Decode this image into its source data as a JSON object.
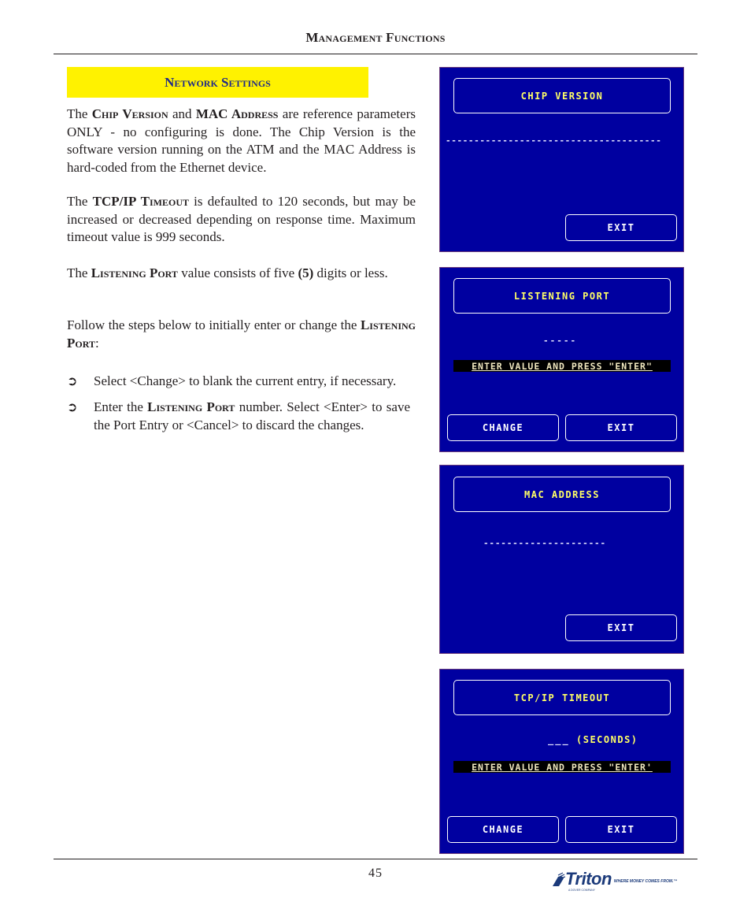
{
  "header": {
    "running_title": "Management Functions"
  },
  "section": {
    "title": "Network Settings"
  },
  "body": {
    "p1": {
      "t1": "The ",
      "chip_version": "Chip Version",
      "t2": " and ",
      "mac": "MAC",
      "address": " Address",
      "t3": " are reference parameters ONLY - no configuring is done.  The Chip Version is the software version running on the ATM and the MAC Address is hard-coded from the Ethernet device."
    },
    "p2": {
      "t1": "The ",
      "tcpip": "TCP/IP ",
      "timeout": "Timeout",
      "t2": " is defaulted to 120 seconds, but may be increased or decreased depending on response time. Maximum timeout value is 999 seconds."
    },
    "p3": {
      "t1": "The ",
      "listening_port": "Listening Port",
      "t2": " value consists of five ",
      "five": "(5)",
      "t3": " digits or less."
    },
    "p4": {
      "t1": "Follow the steps below to initially enter or change the ",
      "listening_port": "Listening Port",
      "t2": ":"
    },
    "steps": [
      {
        "arrow": "➲",
        "t1": "Select <Change> to blank the current entry, if necessary."
      },
      {
        "arrow": "➲",
        "t1": "Enter the ",
        "listening_port": "Listening Port",
        "t2": " number. Select <Enter> to save the Port Entry or <Cancel> to discard  the changes."
      }
    ]
  },
  "screens": {
    "chip_version": {
      "title": "CHIP VERSION",
      "value_placeholder": "--------------------------------------",
      "exit_label": "EXIT"
    },
    "listening_port": {
      "title": "LISTENING PORT",
      "value_placeholder": "-----",
      "prompt": "ENTER VALUE AND PRESS \"ENTER\"",
      "change_label": "CHANGE",
      "exit_label": "EXIT"
    },
    "mac_address": {
      "title": "MAC ADDRESS",
      "value_placeholder": "---------------------",
      "exit_label": "EXIT"
    },
    "tcpip_timeout": {
      "title": "TCP/IP TIMEOUT",
      "value_placeholder": "___",
      "units": "(SECONDS)",
      "prompt": "ENTER VALUE AND PRESS \"ENTER'",
      "change_label": "CHANGE",
      "exit_label": "EXIT"
    }
  },
  "footer": {
    "page_number": "45",
    "logo": {
      "brand": "Triton",
      "tagline": "WHERE MONEY COMES FROM.™",
      "sub": "A DOVER COMPANY"
    }
  },
  "colors": {
    "banner_yellow": "#fff200",
    "banner_text": "#1f2a8a",
    "screen_blue": "#0000a0",
    "screen_title_yellow": "#ffff66",
    "logo_blue": "#1b3a7a"
  }
}
